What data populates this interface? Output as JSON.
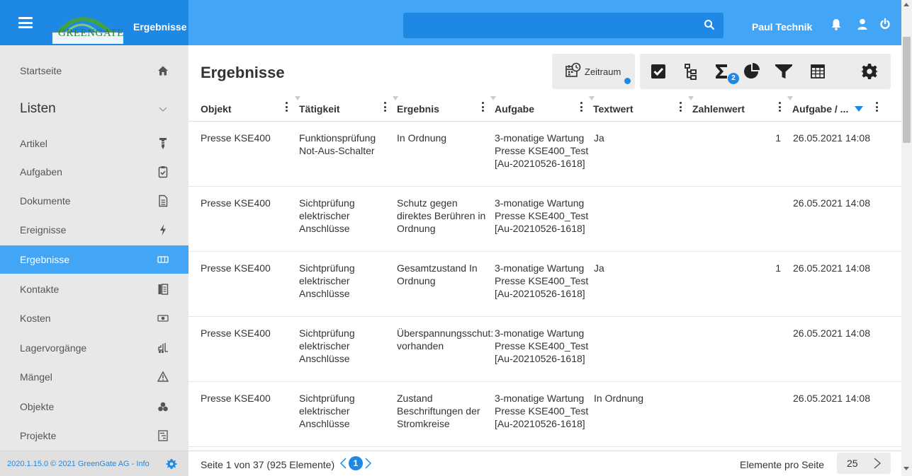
{
  "header": {
    "page_label": "Ergebnisse",
    "logo_text": "GREENGATE",
    "search_placeholder": "",
    "user_name": "Paul Technik",
    "colors": {
      "bar": "#42a5f5",
      "bar_dark": "#1e88e5"
    }
  },
  "sidebar": {
    "items": [
      {
        "label": "Startseite",
        "icon": "home-icon"
      },
      {
        "label": "Listen",
        "icon": "chevron-down-icon",
        "group": true
      },
      {
        "label": "Artikel",
        "icon": "screw-icon"
      },
      {
        "label": "Aufgaben",
        "icon": "clipboard-check-icon"
      },
      {
        "label": "Dokumente",
        "icon": "document-icon"
      },
      {
        "label": "Ereignisse",
        "icon": "lightning-icon"
      },
      {
        "label": "Ergebnisse",
        "icon": "results-icon",
        "active": true
      },
      {
        "label": "Kontakte",
        "icon": "contacts-icon"
      },
      {
        "label": "Kosten",
        "icon": "money-icon"
      },
      {
        "label": "Lagervorgänge",
        "icon": "forklift-icon"
      },
      {
        "label": "Mängel",
        "icon": "warning-icon"
      },
      {
        "label": "Objekte",
        "icon": "objects-icon"
      },
      {
        "label": "Projekte",
        "icon": "projects-icon"
      }
    ],
    "footer": "2020.1.15.0 © 2021 GreenGate AG - Info"
  },
  "main": {
    "title": "Ergebnisse",
    "toolbar": {
      "zeitraum_label": "Zeitraum",
      "sum_badge": "2"
    },
    "columns": [
      "Objekt",
      "Tätigkeit",
      "Ergebnis",
      "Aufgabe",
      "Textwert",
      "Zahlenwert",
      "Aufgabe / ..."
    ],
    "rows": [
      {
        "objekt": "Presse KSE400",
        "taetigkeit": [
          "Funktionsprüfung",
          "Not-Aus-Schalter"
        ],
        "ergebnis": [
          "In Ordnung"
        ],
        "aufgabe": [
          "3-monatige Wartung",
          "Presse KSE400_Test",
          "[Au-20210526-1618]"
        ],
        "textwert": "Ja",
        "zahlenwert": "1",
        "datum": "26.05.2021 14:08"
      },
      {
        "objekt": "Presse KSE400",
        "taetigkeit": [
          "Sichtprüfung",
          "elektrischer",
          "Anschlüsse"
        ],
        "ergebnis": [
          "Schutz gegen",
          "direktes Berühren in",
          "Ordnung"
        ],
        "aufgabe": [
          "3-monatige Wartung",
          "Presse KSE400_Test",
          "[Au-20210526-1618]"
        ],
        "textwert": "",
        "zahlenwert": "",
        "datum": "26.05.2021 14:08"
      },
      {
        "objekt": "Presse KSE400",
        "taetigkeit": [
          "Sichtprüfung",
          "elektrischer",
          "Anschlüsse"
        ],
        "ergebnis": [
          "Gesamtzustand In",
          "Ordnung"
        ],
        "aufgabe": [
          "3-monatige Wartung",
          "Presse KSE400_Test",
          "[Au-20210526-1618]"
        ],
        "textwert": "Ja",
        "zahlenwert": "1",
        "datum": "26.05.2021 14:08"
      },
      {
        "objekt": "Presse KSE400",
        "taetigkeit": [
          "Sichtprüfung",
          "elektrischer",
          "Anschlüsse"
        ],
        "ergebnis": [
          "Überspannungsschut:",
          "vorhanden"
        ],
        "aufgabe": [
          "3-monatige Wartung",
          "Presse KSE400_Test",
          "[Au-20210526-1618]"
        ],
        "textwert": "",
        "zahlenwert": "",
        "datum": "26.05.2021 14:08"
      },
      {
        "objekt": "Presse KSE400",
        "taetigkeit": [
          "Sichtprüfung",
          "elektrischer",
          "Anschlüsse"
        ],
        "ergebnis": [
          "Zustand",
          "Beschriftungen der",
          "Stromkreise"
        ],
        "aufgabe": [
          "3-monatige Wartung",
          "Presse KSE400_Test",
          "[Au-20210526-1618]"
        ],
        "textwert": "In Ordnung",
        "zahlenwert": "",
        "datum": "26.05.2021 14:08"
      }
    ]
  },
  "pager": {
    "summary": "Seite 1 von 37 (925 Elemente)",
    "current_page": "1",
    "per_page_label": "Elemente pro Seite",
    "per_page_value": "25"
  }
}
